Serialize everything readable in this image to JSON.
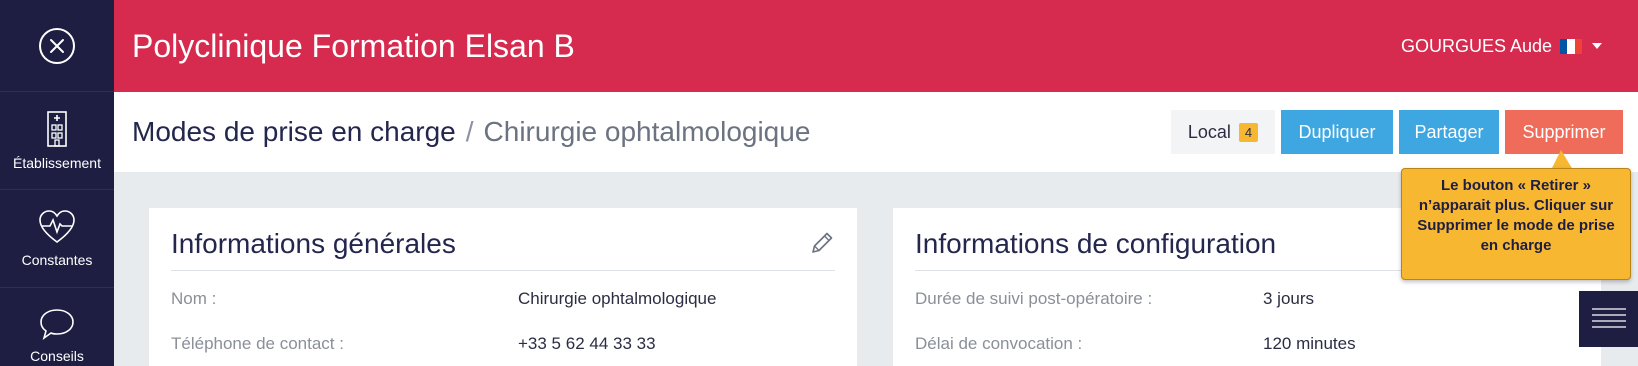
{
  "sidebar": {
    "close_icon": "close-circle-icon",
    "items": [
      {
        "label": "Établissement",
        "icon": "building-icon"
      },
      {
        "label": "Constantes",
        "icon": "heartbeat-icon"
      },
      {
        "label": "Conseils",
        "icon": "speech-bubble-icon"
      }
    ]
  },
  "header": {
    "title": "Polyclinique Formation Elsan B",
    "user": "GOURGUES Aude",
    "flag_colors": [
      "#0055a4",
      "#ffffff",
      "#ef4135"
    ],
    "background": "#d62b4e"
  },
  "breadcrumb": {
    "main": "Modes de prise en charge",
    "separator": "/",
    "current": "Chirurgie ophtalmologique"
  },
  "actions": {
    "local_label": "Local",
    "local_count": "4",
    "duplicate_label": "Dupliquer",
    "share_label": "Partager",
    "delete_label": "Supprimer"
  },
  "general_info": {
    "title": "Informations générales",
    "rows": [
      {
        "label": "Nom :",
        "value": "Chirurgie ophtalmologique"
      },
      {
        "label": "Téléphone de contact :",
        "value": "+33 5 62 44 33 33"
      }
    ]
  },
  "config_info": {
    "title": "Informations de configuration",
    "rows": [
      {
        "label": "Durée de suivi post-opératoire :",
        "value": "3 jours"
      },
      {
        "label": "Délai de convocation :",
        "value": "120 minutes"
      }
    ]
  },
  "tooltip": {
    "text": "Le bouton « Retirer » n’apparait plus. Cliquer sur Supprimer le mode de prise en charge"
  },
  "colors": {
    "sidebar": "#1d1e42",
    "accent_blue": "#3ea6e1",
    "danger": "#ef6b5a",
    "tooltip": "#f7b731"
  }
}
